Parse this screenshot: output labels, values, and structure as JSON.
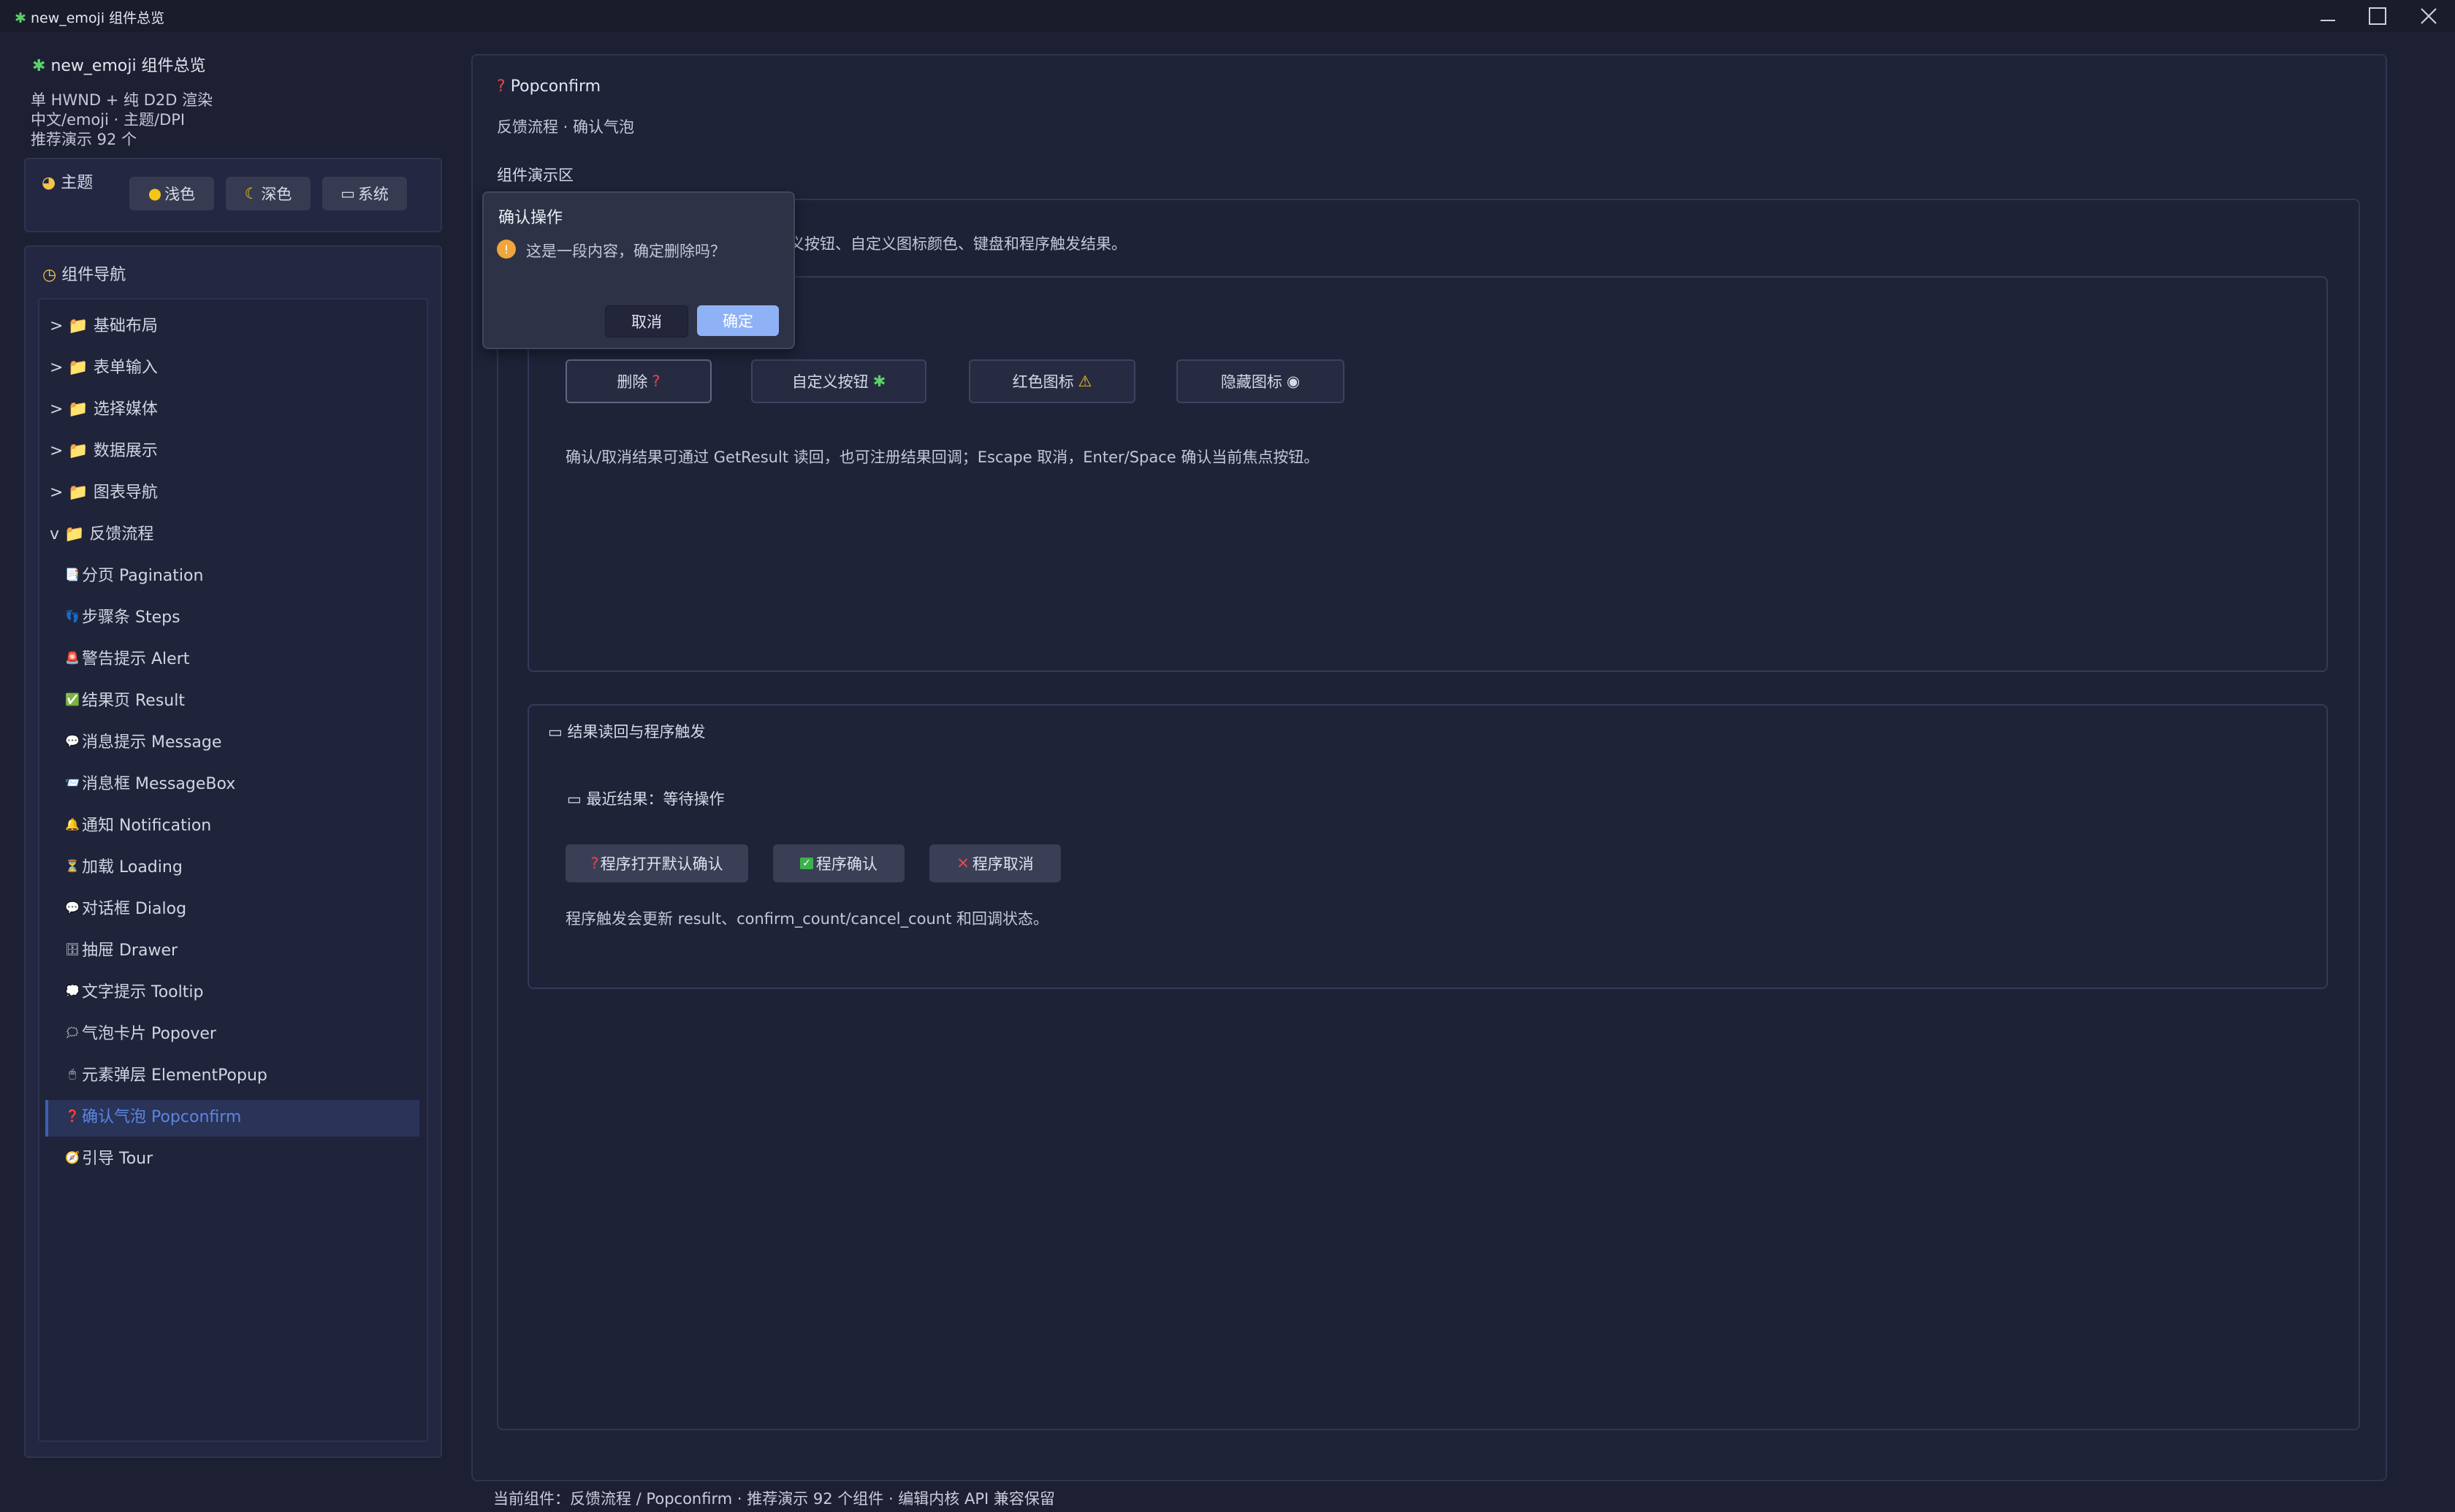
{
  "window": {
    "title": "new_emoji 组件总览",
    "icon": "puzzle-icon",
    "controls": [
      "minimize-icon",
      "maximize-icon",
      "close-icon"
    ]
  },
  "sidebar": {
    "app_title": "new_emoji 组件总览",
    "info_lines": [
      "单 HWND + 纯 D2D 渲染",
      "中文/emoji · 主题/DPI",
      "推荐演示 92 个"
    ],
    "theme": {
      "title": "主题",
      "options": [
        {
          "label": "浅色",
          "icon": "yellow-circle-icon"
        },
        {
          "label": "深色",
          "icon": "moon-icon"
        },
        {
          "label": "系统",
          "icon": "laptop-icon"
        }
      ]
    },
    "nav": {
      "title": "组件导航",
      "groups": [
        {
          "label": "> 📁 基础布局"
        },
        {
          "label": "> 📁 表单输入"
        },
        {
          "label": "> 📁 选择媒体"
        },
        {
          "label": "> 📁 数据展示"
        },
        {
          "label": "> 📁 图表导航"
        },
        {
          "label": "v 📁 反馈流程"
        }
      ],
      "items": [
        {
          "label": "分页 Pagination",
          "icon": "📑"
        },
        {
          "label": "步骤条 Steps",
          "icon": "👣"
        },
        {
          "label": "警告提示 Alert",
          "icon": "🚨"
        },
        {
          "label": "结果页 Result",
          "icon": "✅"
        },
        {
          "label": "消息提示 Message",
          "icon": "💬"
        },
        {
          "label": "消息框 MessageBox",
          "icon": "📨"
        },
        {
          "label": "通知 Notification",
          "icon": "🔔"
        },
        {
          "label": "加载 Loading",
          "icon": "⏳"
        },
        {
          "label": "对话框 Dialog",
          "icon": "💬"
        },
        {
          "label": "抽屉 Drawer",
          "icon": "🗄"
        },
        {
          "label": "文字提示 Tooltip",
          "icon": "💭"
        },
        {
          "label": "气泡卡片 Popover",
          "icon": "🗯"
        },
        {
          "label": "元素弹层 ElementPopup",
          "icon": "🖱"
        },
        {
          "label": "确认气泡 Popconfirm",
          "icon": "❓",
          "active": true
        },
        {
          "label": "引导 Tour",
          "icon": "🧭"
        }
      ]
    }
  },
  "main": {
    "title": "Popconfirm",
    "breadcrumb": "反馈流程 · 确认气泡",
    "demo_label": "组件演示区",
    "description_visible": "义按钮、自定义图标颜色、键盘和程序触发结果。",
    "buttons": [
      {
        "label": "删除",
        "icon": "❓"
      },
      {
        "label": "自定义按钮",
        "icon": "🧩"
      },
      {
        "label": "红色图标",
        "icon": "⚠"
      },
      {
        "label": "隐藏图标",
        "icon": "👁"
      }
    ],
    "note": "确认/取消结果可通过 GetResult 读回，也可注册结果回调；Escape 取消，Enter/Space 确认当前焦点按钮。",
    "results_card": {
      "title": "结果读回与程序触发",
      "latest_label": "最近结果：等待操作",
      "actions": [
        {
          "label": "程序打开默认确认",
          "icon": "❓"
        },
        {
          "label": "程序确认",
          "icon": "✅"
        },
        {
          "label": "程序取消",
          "icon": "❌"
        }
      ],
      "footnote": "程序触发会更新 result、confirm_count/cancel_count 和回调状态。"
    }
  },
  "popconfirm": {
    "title": "确认操作",
    "message": "这是一段内容，确定删除吗？",
    "cancel": "取消",
    "confirm": "确定",
    "colors": {
      "confirm_bg": "#8fb2f6",
      "warning": "#f0a63a"
    }
  },
  "status_bar": "当前组件：反馈流程 / Popconfirm · 推荐演示 92 个组件 · 编辑内核 API 兼容保留",
  "colors": {
    "accent": "#3d5fb0",
    "background": "#1d2033"
  }
}
